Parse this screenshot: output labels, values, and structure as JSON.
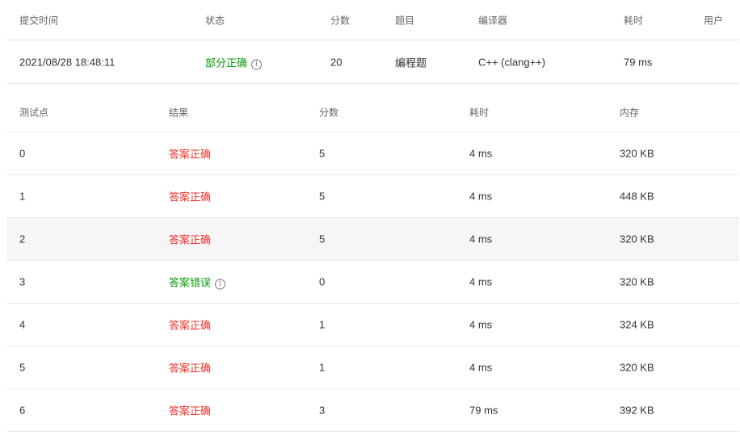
{
  "submission": {
    "headers": [
      "提交时间",
      "状态",
      "分数",
      "题目",
      "编译器",
      "耗时",
      "用户"
    ],
    "row": {
      "time": "2021/08/28 18:48:11",
      "status": "部分正确",
      "score": "20",
      "problem": "编程题",
      "compiler": "C++ (clang++)",
      "elapsed": "79 ms",
      "user": ""
    }
  },
  "testcases": {
    "headers": [
      "测试点",
      "结果",
      "分数",
      "耗时",
      "内存"
    ],
    "rows": [
      {
        "id": "0",
        "result": "答案正确",
        "ok": true,
        "score": "5",
        "time": "4 ms",
        "memory": "320 KB"
      },
      {
        "id": "1",
        "result": "答案正确",
        "ok": true,
        "score": "5",
        "time": "4 ms",
        "memory": "448 KB"
      },
      {
        "id": "2",
        "result": "答案正确",
        "ok": true,
        "score": "5",
        "time": "4 ms",
        "memory": "320 KB"
      },
      {
        "id": "3",
        "result": "答案错误",
        "ok": false,
        "score": "0",
        "time": "4 ms",
        "memory": "320 KB"
      },
      {
        "id": "4",
        "result": "答案正确",
        "ok": true,
        "score": "1",
        "time": "4 ms",
        "memory": "324 KB"
      },
      {
        "id": "5",
        "result": "答案正确",
        "ok": true,
        "score": "1",
        "time": "4 ms",
        "memory": "320 KB"
      },
      {
        "id": "6",
        "result": "答案正确",
        "ok": true,
        "score": "3",
        "time": "79 ms",
        "memory": "392 KB"
      }
    ]
  },
  "colors": {
    "correct": "#f5312a",
    "wrong": "#0a9e0a",
    "partial": "#0a9e0a"
  },
  "icons": {
    "info": "info-circle-icon"
  }
}
